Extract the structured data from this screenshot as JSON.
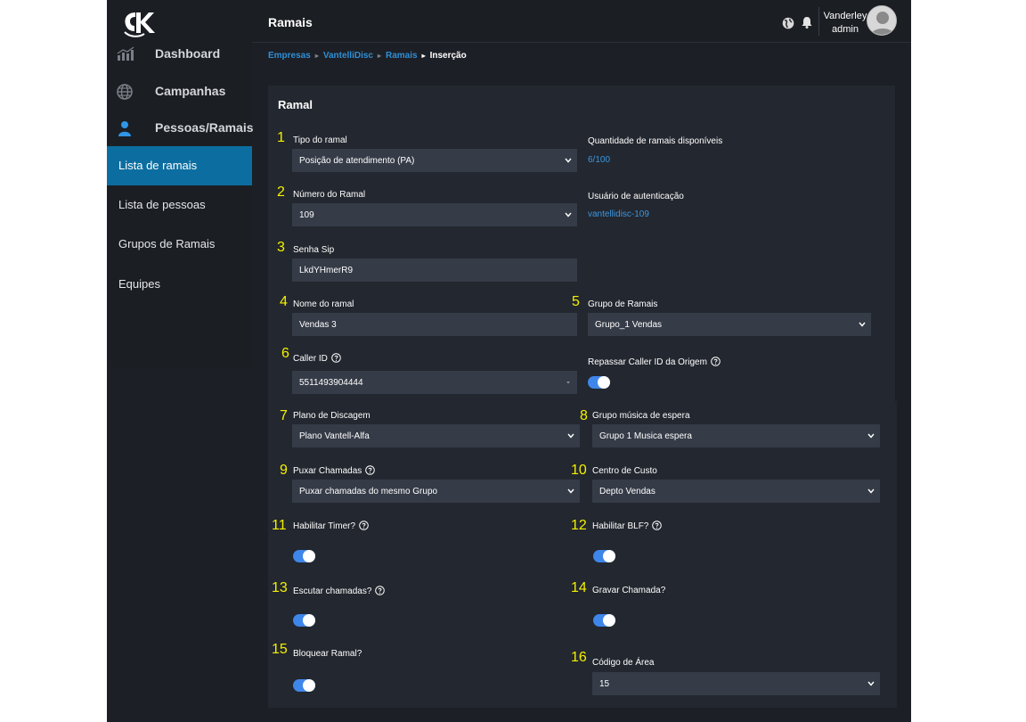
{
  "colors": {
    "accent": "#0c6ea0",
    "link": "#3b97e0",
    "toggle": "#3f86ea",
    "annotation": "#f4f000",
    "field_bg": "#353b47",
    "panel_bg": "#23272f"
  },
  "header": {
    "title": "Ramais"
  },
  "user": {
    "name": "Vanderley",
    "role": "admin"
  },
  "sidebar": {
    "top_items": [
      {
        "label": "Dashboard",
        "icon": "chart-icon"
      },
      {
        "label": "Campanhas",
        "icon": "globe-icon"
      },
      {
        "label": "Pessoas/Ramais",
        "icon": "person-icon"
      }
    ],
    "sub_items": [
      {
        "label": "Lista de ramais",
        "active": true
      },
      {
        "label": "Lista de pessoas"
      },
      {
        "label": "Grupos de Ramais"
      },
      {
        "label": "Equipes"
      }
    ]
  },
  "breadcrumb": {
    "items": [
      "Empresas",
      "VantelliDisc",
      "Ramais"
    ],
    "current": "Inserção"
  },
  "form": {
    "title": "Ramal",
    "fields": {
      "tipo": {
        "num": "1",
        "label": "Tipo do ramal",
        "value": "Posição de atendimento (PA)"
      },
      "numero": {
        "num": "2",
        "label": "Número do Ramal",
        "value": "109"
      },
      "senha": {
        "num": "3",
        "label": "Senha Sip",
        "value": "LkdYHmerR9"
      },
      "nome": {
        "num": "4",
        "label": "Nome do ramal",
        "value": "Vendas 3"
      },
      "grupo": {
        "num": "5",
        "label": "Grupo de Ramais",
        "value": "Grupo_1 Vendas"
      },
      "callerid": {
        "num": "6",
        "label": "Caller ID",
        "value": "5511493904444"
      },
      "plano": {
        "num": "7",
        "label": "Plano de Discagem",
        "value": "Plano Vantell-Alfa"
      },
      "musica": {
        "num": "8",
        "label": "Grupo música de espera",
        "value": "Grupo 1 Musica espera"
      },
      "puxar": {
        "num": "9",
        "label": "Puxar Chamadas",
        "value": "Puxar chamadas do mesmo Grupo"
      },
      "custo": {
        "num": "10",
        "label": "Centro de Custo",
        "value": "Depto Vendas"
      },
      "timer": {
        "num": "11",
        "label": "Habilitar Timer?",
        "on": true
      },
      "blf": {
        "num": "12",
        "label": "Habilitar BLF?",
        "on": true
      },
      "escutar": {
        "num": "13",
        "label": "Escutar chamadas?",
        "on": true
      },
      "gravar": {
        "num": "14",
        "label": "Gravar Chamada?",
        "on": true
      },
      "bloquear": {
        "num": "15",
        "label": "Bloquear Ramal?",
        "on": true
      },
      "area": {
        "num": "16",
        "label": "Código de Área",
        "value": "15"
      }
    },
    "info": {
      "quantidade_label": "Quantidade de ramais disponíveis",
      "quantidade_value": "6/100",
      "usuario_label": "Usuário de autenticação",
      "usuario_value": "vantellidisc-109",
      "repassar_label": "Repassar Caller ID da Origem",
      "repassar_on": true
    }
  }
}
